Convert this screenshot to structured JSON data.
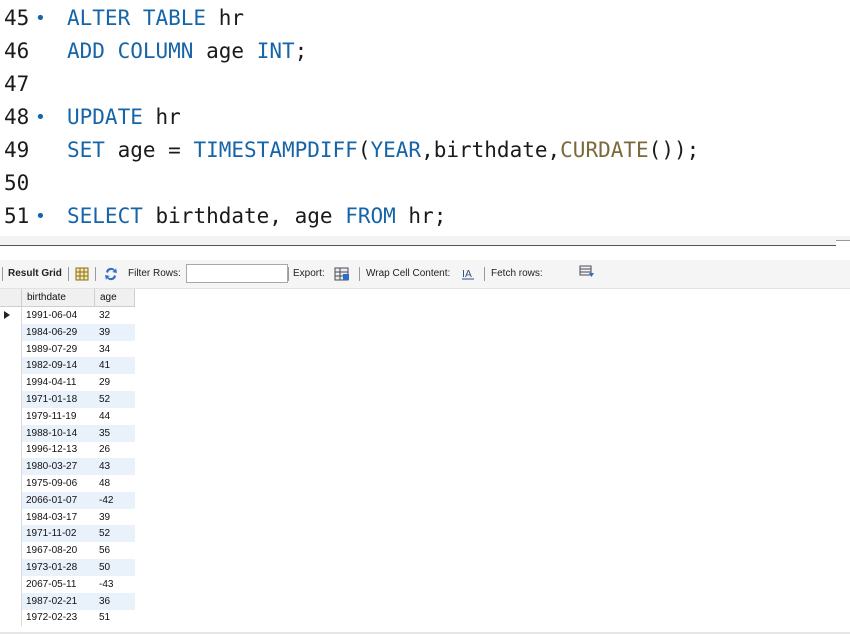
{
  "editor": {
    "lines": [
      {
        "num": "45",
        "dot": true,
        "parts": [
          [
            "kw",
            "ALTER TABLE"
          ],
          [
            "",
            "hr"
          ]
        ]
      },
      {
        "num": "46",
        "dot": false,
        "parts": [
          [
            "kw",
            "ADD COLUMN"
          ],
          [
            "",
            "age"
          ],
          [
            "kw",
            "INT"
          ],
          [
            "",
            ";"
          ]
        ]
      },
      {
        "num": "47",
        "dot": false,
        "parts": []
      },
      {
        "num": "48",
        "dot": true,
        "parts": [
          [
            "kw",
            "UPDATE"
          ],
          [
            "",
            "hr"
          ]
        ]
      },
      {
        "num": "49",
        "dot": false,
        "parts": [
          [
            "kw",
            "SET"
          ],
          [
            "",
            "age ="
          ],
          [
            "fn",
            "TIMESTAMPDIFF"
          ],
          [
            "",
            "("
          ],
          [
            "kw",
            "YEAR"
          ],
          [
            "",
            ",birthdate,"
          ],
          [
            "fn2",
            "CURDATE"
          ],
          [
            "",
            "());"
          ]
        ]
      },
      {
        "num": "50",
        "dot": false,
        "parts": []
      },
      {
        "num": "51",
        "dot": true,
        "parts": [
          [
            "kw",
            "SELECT"
          ],
          [
            "",
            "birthdate, age"
          ],
          [
            "kw",
            "FROM"
          ],
          [
            "",
            "hr;"
          ]
        ]
      }
    ]
  },
  "toolbar": {
    "result_grid": "Result Grid",
    "filter_rows": "Filter Rows:",
    "filter_value": "",
    "export": "Export:",
    "wrap": "Wrap Cell Content:",
    "fetch": "Fetch rows:"
  },
  "grid": {
    "columns": [
      "birthdate",
      "age"
    ],
    "rows": [
      [
        "1991-06-04",
        "32"
      ],
      [
        "1984-06-29",
        "39"
      ],
      [
        "1989-07-29",
        "34"
      ],
      [
        "1982-09-14",
        "41"
      ],
      [
        "1994-04-11",
        "29"
      ],
      [
        "1971-01-18",
        "52"
      ],
      [
        "1979-11-19",
        "44"
      ],
      [
        "1988-10-14",
        "35"
      ],
      [
        "1996-12-13",
        "26"
      ],
      [
        "1980-03-27",
        "43"
      ],
      [
        "1975-09-06",
        "48"
      ],
      [
        "2066-01-07",
        "-42"
      ],
      [
        "1984-03-17",
        "39"
      ],
      [
        "1971-11-02",
        "52"
      ],
      [
        "1967-08-20",
        "56"
      ],
      [
        "1973-01-28",
        "50"
      ],
      [
        "2067-05-11",
        "-43"
      ],
      [
        "1987-02-21",
        "36"
      ],
      [
        "1972-02-23",
        "51"
      ]
    ]
  }
}
